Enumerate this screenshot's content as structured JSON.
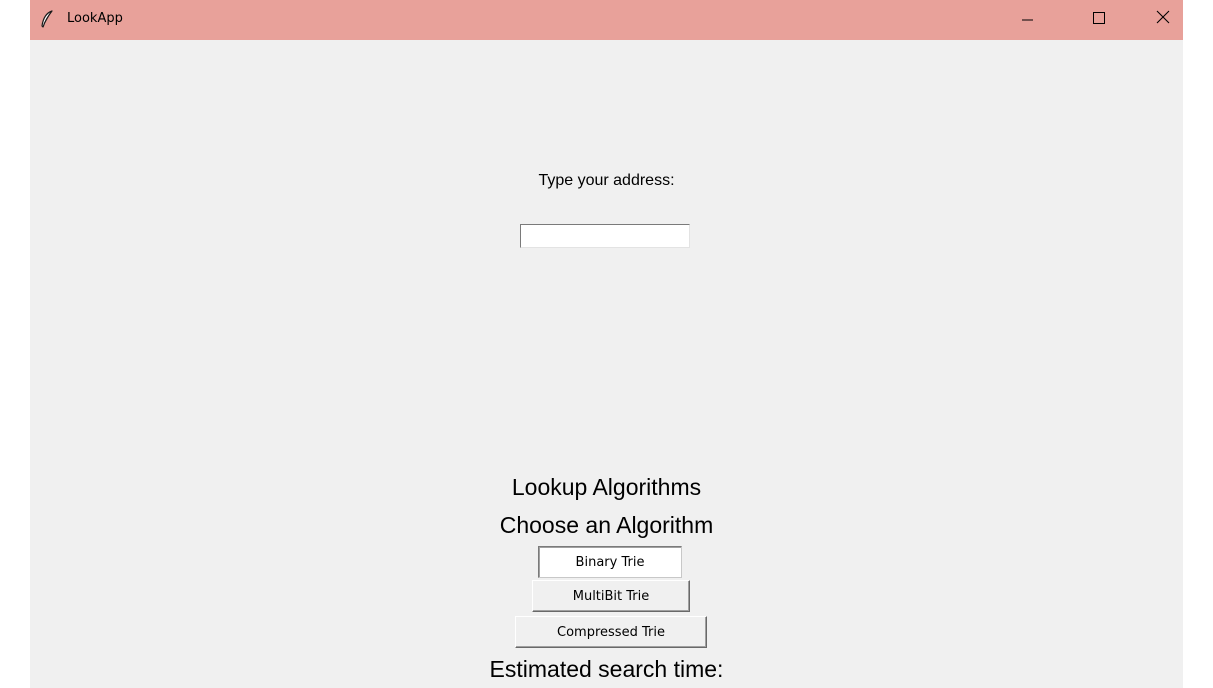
{
  "window": {
    "title": "LookApp",
    "titlebar_color": "#e8a19a",
    "background_color": "#f0f0f0",
    "app_icon": "feather-icon",
    "controls": {
      "minimize_icon": "minimize-icon",
      "maximize_icon": "maximize-icon",
      "close_icon": "close-icon"
    }
  },
  "form": {
    "address_label": "Type your address:",
    "address_value": "",
    "address_placeholder": ""
  },
  "algorithms": {
    "heading": "Lookup Algorithms",
    "subheading": "Choose an Algorithm",
    "options": [
      {
        "label": "Binary Trie",
        "selected": true
      },
      {
        "label": "MultiBit Trie",
        "selected": false
      },
      {
        "label": "Compressed Trie",
        "selected": false
      }
    ]
  },
  "result": {
    "estimate_label": "Estimated search time:"
  }
}
